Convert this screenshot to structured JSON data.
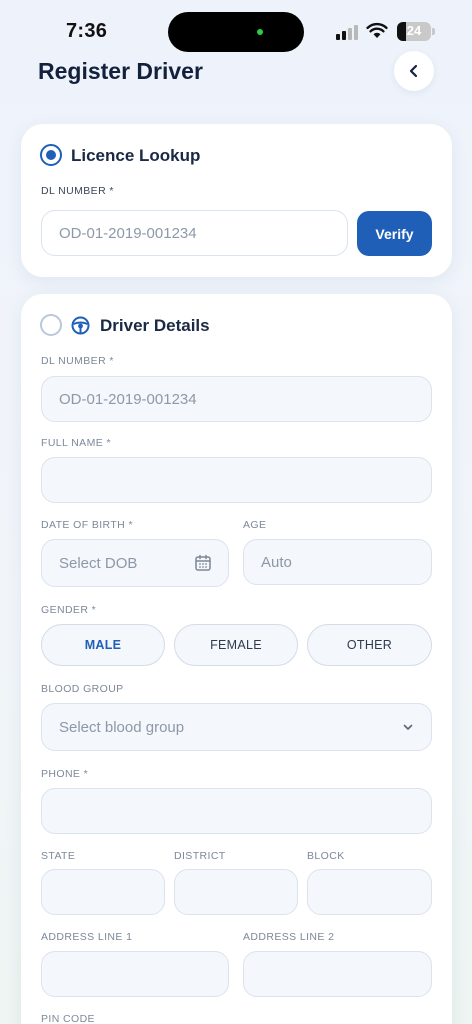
{
  "status_bar": {
    "time": "7:36",
    "battery": "24"
  },
  "header": {
    "title": "Register Driver"
  },
  "licence_lookup": {
    "title": "Licence Lookup",
    "dl_label": "DL NUMBER *",
    "dl_placeholder": "OD-01-2019-001234",
    "verify_label": "Verify"
  },
  "driver_details": {
    "title": "Driver Details",
    "dl_label": "DL NUMBER *",
    "dl_value": "OD-01-2019-001234",
    "full_name_label": "FULL NAME *",
    "full_name_value": "",
    "dob_label": "DATE OF BIRTH *",
    "dob_placeholder": "Select DOB",
    "age_label": "AGE",
    "age_placeholder": "Auto",
    "gender_label": "GENDER *",
    "gender_options": [
      "MALE",
      "FEMALE",
      "OTHER"
    ],
    "gender_selected": "MALE",
    "blood_group_label": "BLOOD GROUP",
    "blood_group_placeholder": "Select blood group",
    "phone_label": "PHONE *",
    "state_label": "STATE",
    "district_label": "DISTRICT",
    "block_label": "BLOCK",
    "address1_label": "ADDRESS LINE 1",
    "address2_label": "ADDRESS LINE 2",
    "pin_label": "PIN CODE"
  },
  "colors": {
    "accent": "#1f5fb8",
    "title": "#14213d",
    "field_bg": "#f4f7fb",
    "field_border": "#dbe3ee"
  }
}
